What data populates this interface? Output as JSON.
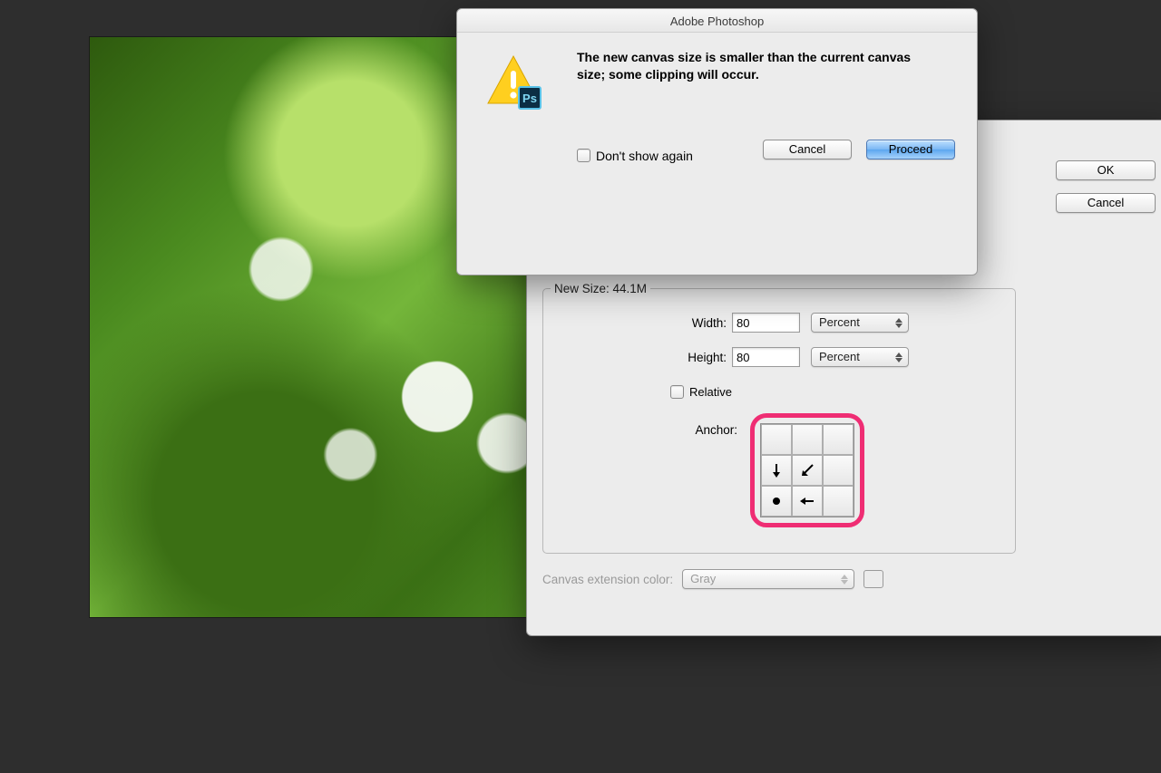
{
  "alert": {
    "title": "Adobe Photoshop",
    "message": "The new canvas size is smaller than the current canvas size; some clipping will occur.",
    "dont_show_label": "Don't show again",
    "cancel_label": "Cancel",
    "proceed_label": "Proceed",
    "app_badge": "Ps"
  },
  "canvasSize": {
    "new_size_legend": "New Size: 44.1M",
    "width_label": "Width:",
    "width_value": "80",
    "width_unit": "Percent",
    "height_label": "Height:",
    "height_value": "80",
    "height_unit": "Percent",
    "relative_label": "Relative",
    "anchor_label": "Anchor:",
    "extension_label": "Canvas extension color:",
    "extension_value": "Gray",
    "ok_label": "OK",
    "cancel_label": "Cancel"
  }
}
